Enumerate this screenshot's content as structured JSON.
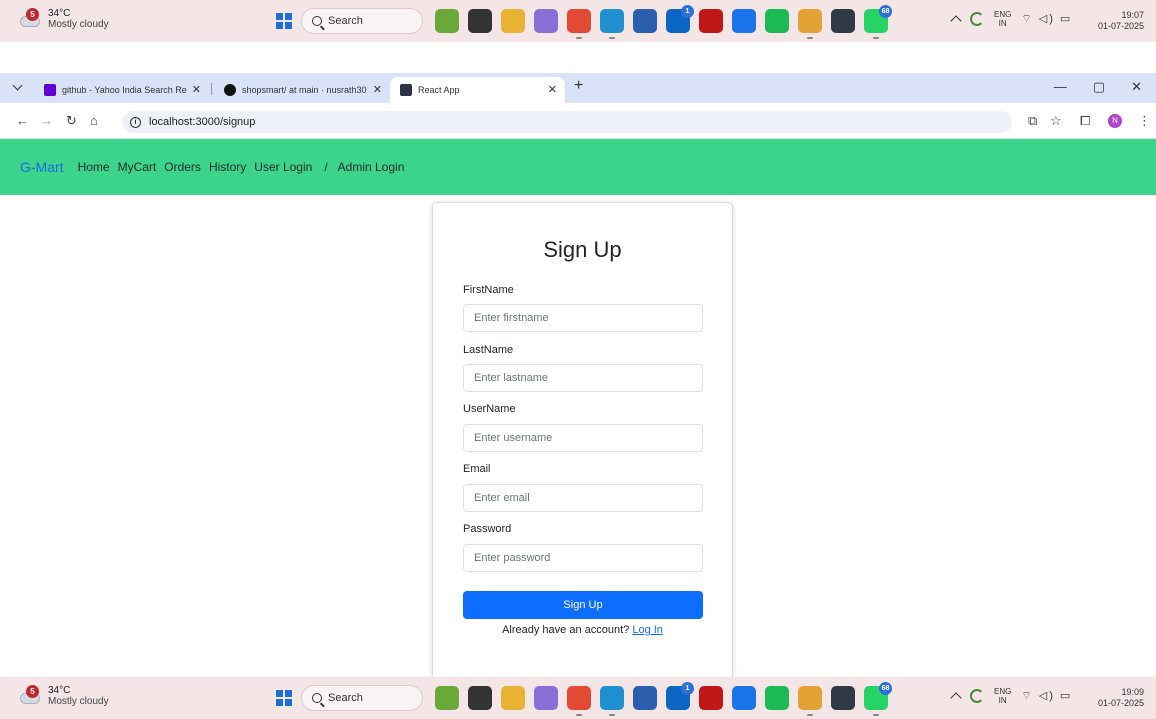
{
  "taskbar": {
    "weather_temp": "34°C",
    "weather_desc": "Mostly cloudy",
    "weather_alert": "5",
    "search_label": "Search",
    "lang_line1": "ENG",
    "lang_line2": "IN",
    "apps": [
      {
        "name": "plant-app-icon",
        "color": "#6aa83a"
      },
      {
        "name": "file-app-icon",
        "color": "#333333"
      },
      {
        "name": "file-explorer-icon",
        "color": "#e8b233"
      },
      {
        "name": "copilot-icon",
        "color": "#8a6fd6"
      },
      {
        "name": "chrome-icon",
        "color": "#e24a35"
      },
      {
        "name": "edge-icon",
        "color": "#1f8fd0"
      },
      {
        "name": "store-icon",
        "color": "#2b5fad"
      },
      {
        "name": "linkedin-icon",
        "color": "#0a66c2",
        "badge": "1"
      },
      {
        "name": "mcafee-icon",
        "color": "#c01818"
      },
      {
        "name": "outlook-icon",
        "color": "#1a73e8"
      },
      {
        "name": "spotify-icon",
        "color": "#1db954"
      },
      {
        "name": "chrome-active-icon",
        "color": "#e2a235"
      },
      {
        "name": "terminal-icon",
        "color": "#2f3a45"
      },
      {
        "name": "whatsapp-icon",
        "color": "#25d366",
        "badge": "68"
      }
    ]
  },
  "clock_top": {
    "time": "19:07",
    "date": "01-07-2025"
  },
  "clock_bottom": {
    "time": "19:09",
    "date": "01-07-2025"
  },
  "browser": {
    "tabs": [
      {
        "title": "github - Yahoo India Search Re",
        "favicon_color": "#6001d2"
      },
      {
        "title": "shopsmart/ at main · nusrath30",
        "favicon_color": "#111111"
      },
      {
        "title": "React App",
        "favicon_color": "#2b3445"
      }
    ],
    "url": "localhost:3000/signup",
    "profile_initial": "N"
  },
  "navbar": {
    "brand": "G-Mart",
    "links": [
      "Home",
      "MyCart",
      "Orders",
      "History",
      "User Login",
      "Admin Login"
    ],
    "separator": "/"
  },
  "form": {
    "title": "Sign Up",
    "fields": [
      {
        "label": "FirstName",
        "placeholder": "Enter firstname"
      },
      {
        "label": "LastName",
        "placeholder": "Enter lastname"
      },
      {
        "label": "UserName",
        "placeholder": "Enter username"
      },
      {
        "label": "Email",
        "placeholder": "Enter email"
      },
      {
        "label": "Password",
        "placeholder": "Enter password"
      }
    ],
    "submit_label": "Sign Up",
    "login_prompt": "Already have an account?",
    "login_link": "Log In"
  },
  "colors": {
    "navbar_bg": "#3cd38b",
    "brand": "#1a6ee0",
    "primary": "#0d6efd"
  }
}
